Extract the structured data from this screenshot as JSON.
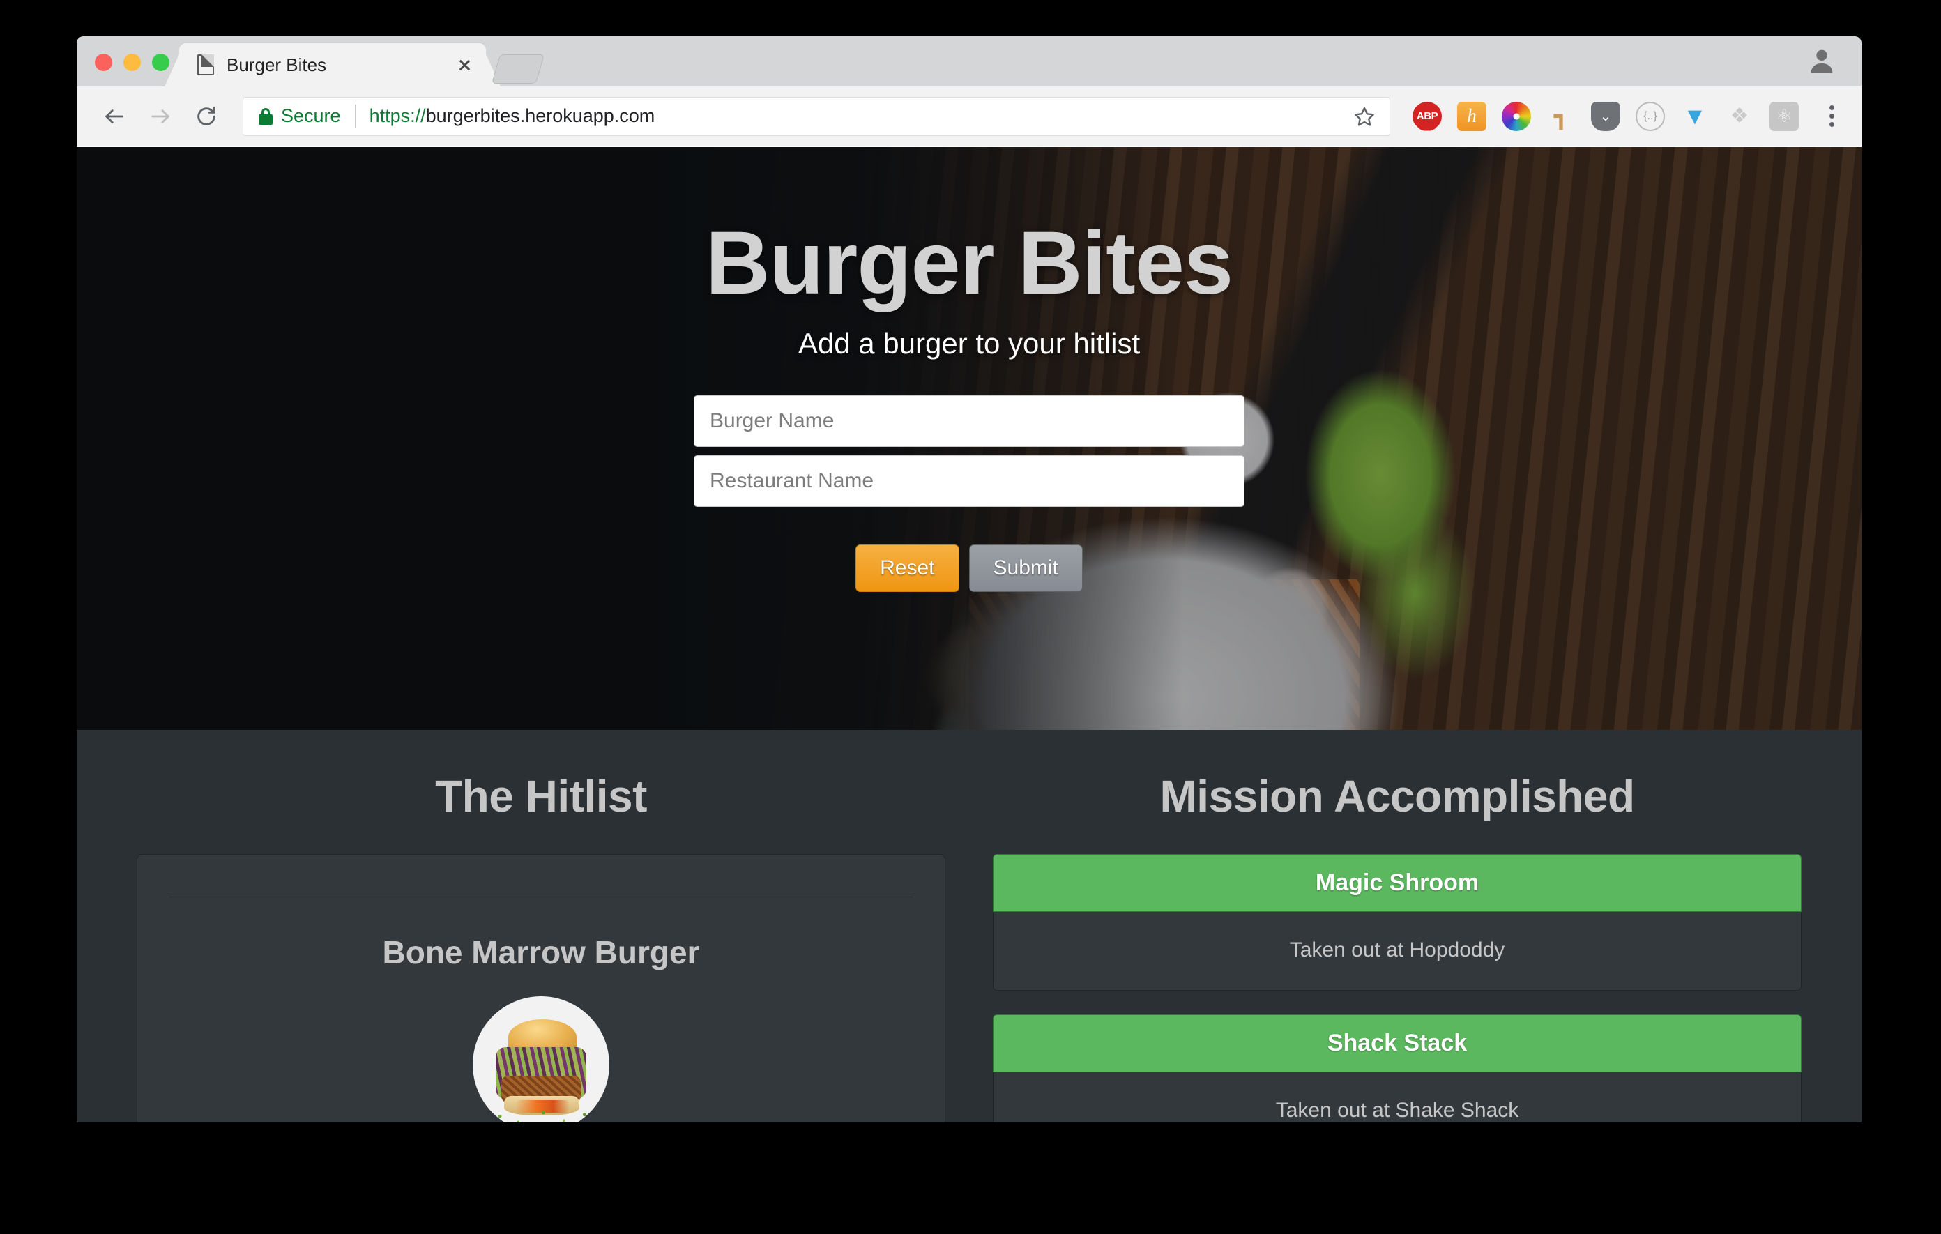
{
  "browser": {
    "tab": {
      "title": "Burger Bites",
      "favicon": "page-icon",
      "close_label": "x"
    },
    "new_tab_label": "+",
    "traffic_lights": [
      "close",
      "minimize",
      "zoom"
    ],
    "toolbar": {
      "back_label": "Back",
      "forward_label": "Forward",
      "reload_label": "Reload",
      "security_label": "Secure",
      "url_scheme": "https://",
      "url_rest": "burgerbites.herokuapp.com",
      "url_full": "https://burgerbites.herokuapp.com",
      "bookmark_label": "Bookmark this page",
      "menu_label": "Customize and control Google Chrome"
    },
    "extensions": [
      {
        "name": "adblock-plus-extension",
        "glyph": "ABP"
      },
      {
        "name": "honey-extension",
        "glyph": "h"
      },
      {
        "name": "colorzilla-extension",
        "glyph": ""
      },
      {
        "name": "ruler-extension",
        "glyph": "┓"
      },
      {
        "name": "pocket-extension",
        "glyph": "⌄"
      },
      {
        "name": "json-formatter-extension",
        "glyph": "{..}"
      },
      {
        "name": "yandex-extension",
        "glyph": "▼"
      },
      {
        "name": "dropbox-extension",
        "glyph": "❖"
      },
      {
        "name": "react-devtools-extension",
        "glyph": "⚛"
      }
    ],
    "profile_label": "Profile"
  },
  "hero": {
    "title": "Burger Bites",
    "subtitle": "Add a burger to your hitlist",
    "form": {
      "burger_name_placeholder": "Burger Name",
      "burger_name_value": "",
      "restaurant_name_placeholder": "Restaurant Name",
      "restaurant_name_value": "",
      "reset_label": "Reset",
      "submit_label": "Submit"
    }
  },
  "hitlist": {
    "title": "The Hitlist",
    "items": [
      {
        "name": "Bone Marrow Burger",
        "photo": "burger-photo"
      }
    ]
  },
  "accomplished": {
    "title": "Mission Accomplished",
    "items": [
      {
        "name": "Magic Shroom",
        "detail": "Taken out at Hopdoddy"
      },
      {
        "name": "Shack Stack",
        "detail": "Taken out at Shake Shack"
      }
    ]
  },
  "colors": {
    "accent_orange": "#ef9612",
    "accent_green": "#5cb85f",
    "secure_green": "#0b7c34",
    "page_bg": "#2b3034",
    "card_bg": "#33383c",
    "heading_gray": "#c6c6c6"
  }
}
